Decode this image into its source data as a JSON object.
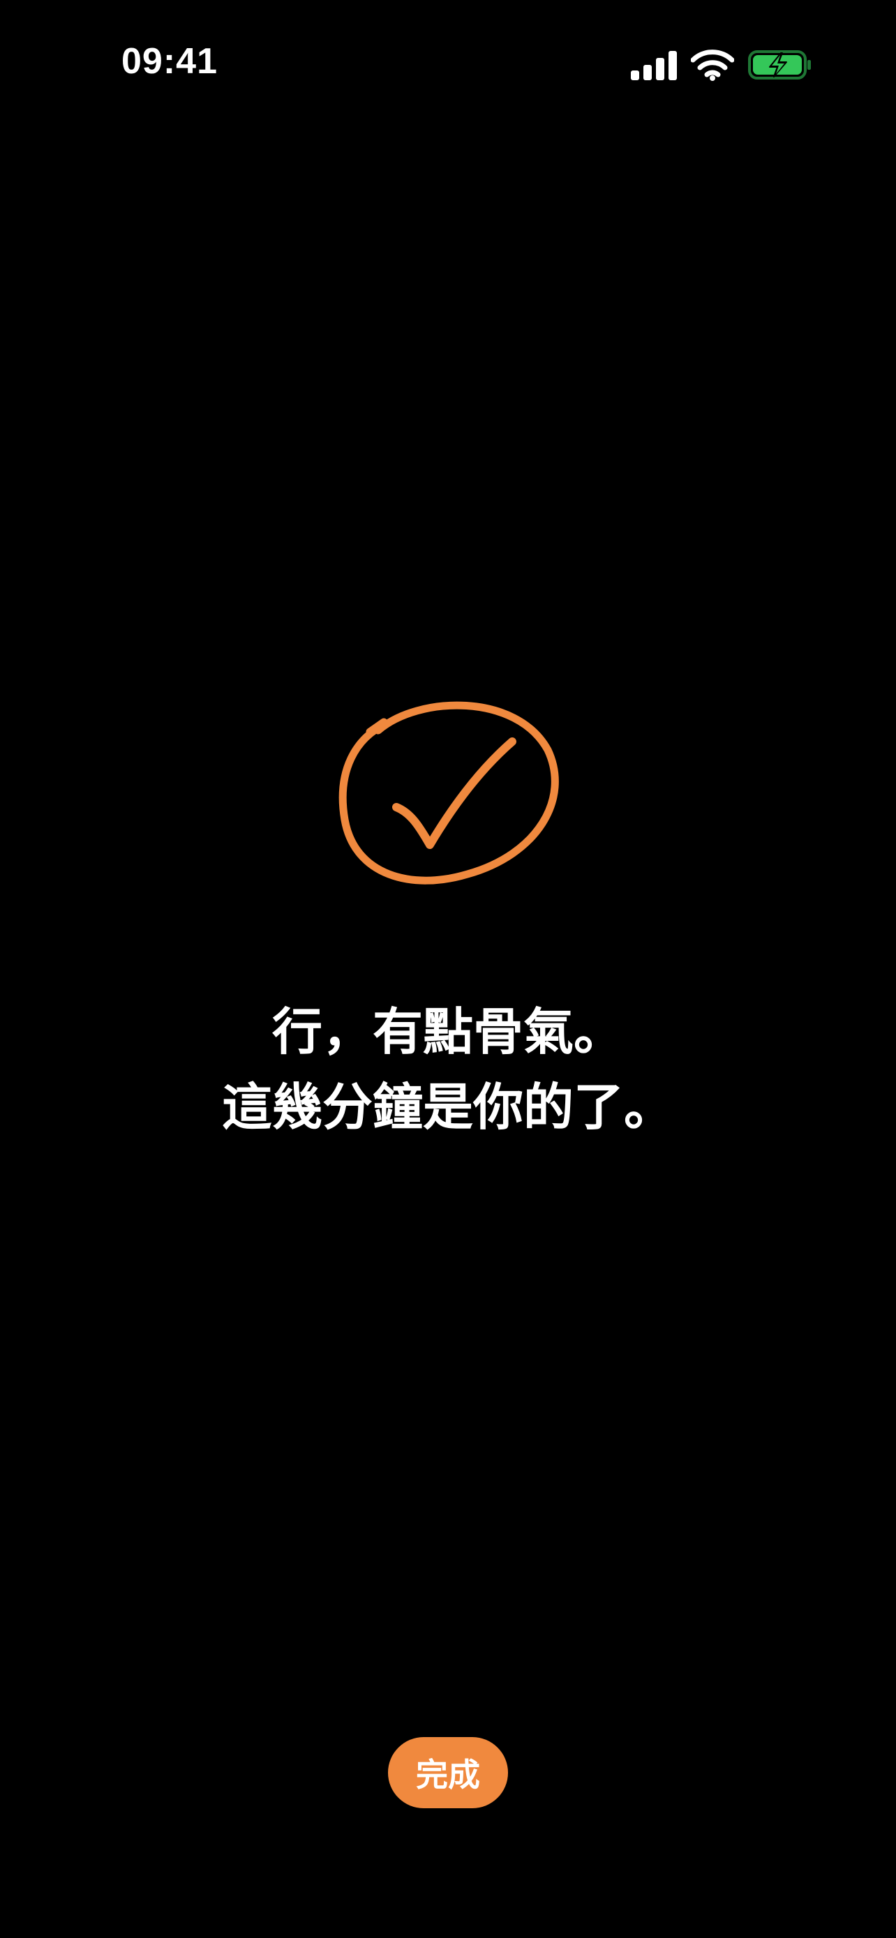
{
  "status_bar": {
    "time": "09:41",
    "battery_color": "#34c759"
  },
  "message": {
    "line1": "行，有點骨氣。",
    "line2": "這幾分鐘是你的了。"
  },
  "done_button": {
    "label": "完成"
  },
  "colors": {
    "background": "#000000",
    "accent": "#f0893e",
    "text": "#ffffff"
  },
  "icons": {
    "signal": "cellular-signal-icon",
    "wifi": "wifi-icon",
    "battery": "battery-charging-icon",
    "check": "hand-drawn-check-circle-icon"
  }
}
